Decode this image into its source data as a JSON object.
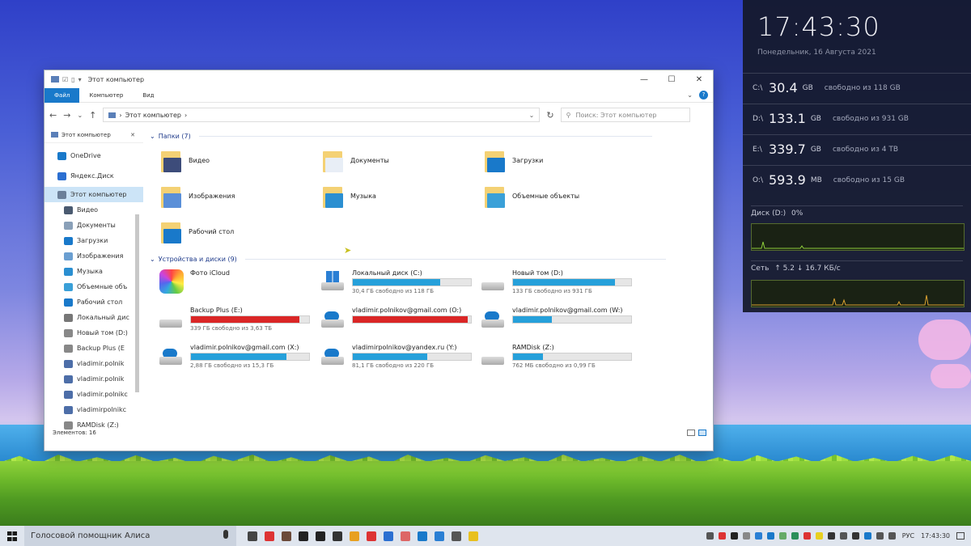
{
  "window": {
    "title": "Этот компьютер",
    "ribbon_tabs": [
      "Файл",
      "Компьютер",
      "Вид"
    ],
    "address_path": "Этот компьютер",
    "search_placeholder": "Поиск: Этот компьютер",
    "quick_access_label": "Этот компьютер",
    "status_text": "Элементов: 16"
  },
  "sidebar": {
    "items": [
      {
        "label": "OneDrive",
        "color": "#1979ca"
      },
      {
        "label": "Яндекс.Диск",
        "color": "#2b6fd1"
      },
      {
        "label": "Этот компьютер",
        "color": "#6b7f99"
      },
      {
        "label": "Видео",
        "color": "#4a5a70"
      },
      {
        "label": "Документы",
        "color": "#8aa0b8"
      },
      {
        "label": "Загрузки",
        "color": "#1979ca"
      },
      {
        "label": "Изображения",
        "color": "#6b9fd1"
      },
      {
        "label": "Музыка",
        "color": "#2b8fd1"
      },
      {
        "label": "Объемные объ",
        "color": "#3aa0d8"
      },
      {
        "label": "Рабочий стол",
        "color": "#1979ca"
      },
      {
        "label": "Локальный дис",
        "color": "#777"
      },
      {
        "label": "Новый том (D:)",
        "color": "#888"
      },
      {
        "label": "Backup Plus (E",
        "color": "#888"
      },
      {
        "label": "vladimir.polnik",
        "color": "#4d6ea8"
      },
      {
        "label": "vladimir.polnik",
        "color": "#4d6ea8"
      },
      {
        "label": "vladimir.polnikc",
        "color": "#4d6ea8"
      },
      {
        "label": "vladimirpolnikc",
        "color": "#4d6ea8"
      },
      {
        "label": "RAMDisk (Z:)",
        "color": "#888"
      }
    ]
  },
  "folders_group": "Папки (7)",
  "folders": [
    {
      "label": "Видео",
      "accent": "#3d4c7a"
    },
    {
      "label": "Документы",
      "accent": "#e8eef6"
    },
    {
      "label": "Загрузки",
      "accent": "#1979ca"
    },
    {
      "label": "Изображения",
      "accent": "#5a8fd8"
    },
    {
      "label": "Музыка",
      "accent": "#2b8fd1"
    },
    {
      "label": "Объемные объекты",
      "accent": "#3aa0d8"
    },
    {
      "label": "Рабочий стол",
      "accent": "#1979ca"
    }
  ],
  "devices_group": "Устройства и диски (9)",
  "drives": [
    {
      "label": "Фото iCloud",
      "kind": "icloud",
      "fill": null,
      "free": ""
    },
    {
      "label": "Локальный диск (C:)",
      "kind": "win",
      "fill": 0.74,
      "color": "#26a0da",
      "free": "30,4 ГБ свободно из 118 ГБ"
    },
    {
      "label": "Новый том (D:)",
      "kind": "hdd",
      "fill": 0.86,
      "color": "#26a0da",
      "free": "133 ГБ свободно из 931 ГБ"
    },
    {
      "label": "Backup Plus  (E:)",
      "kind": "hdd",
      "fill": 0.92,
      "color": "#da2626",
      "free": "339 ГБ свободно из 3,63 ТБ"
    },
    {
      "label": "vladimir.polnikov@gmail.com (O:)",
      "kind": "cloud",
      "fill": 0.97,
      "color": "#da2626",
      "free": ""
    },
    {
      "label": "vladimir.polnikov@gmail.com (W:)",
      "kind": "cloud",
      "fill": 0.33,
      "color": "#26a0da",
      "free": ""
    },
    {
      "label": "vladimir.polnikov@gmail.com (X:)",
      "kind": "cloud",
      "fill": 0.81,
      "color": "#26a0da",
      "free": "2,88 ГБ свободно из 15,3 ГБ"
    },
    {
      "label": "vladimirpolnikov@yandex.ru (Y:)",
      "kind": "cloud",
      "fill": 0.63,
      "color": "#26a0da",
      "free": "81,1 ГБ свободно из 220 ГБ"
    },
    {
      "label": "RAMDisk (Z:)",
      "kind": "hdd",
      "fill": 0.25,
      "color": "#26a0da",
      "free": "762 МБ свободно из 0,99 ГБ"
    }
  ],
  "widget": {
    "clock": "17:43:30",
    "date": "Понедельник, 16 Августа 2021",
    "disks": [
      {
        "letter": "C:\\",
        "value": "30.4",
        "unit": "GB",
        "free": "свободно из 118 GB"
      },
      {
        "letter": "D:\\",
        "value": "133.1",
        "unit": "GB",
        "free": "свободно из 931 GB"
      },
      {
        "letter": "E:\\",
        "value": "339.7",
        "unit": "GB",
        "free": "свободно из 4 TB"
      },
      {
        "letter": "O:\\",
        "value": "593.9",
        "unit": "MB",
        "free": "свободно из 15 GB"
      }
    ],
    "disk_activity_label": "Диск (D:)",
    "disk_activity_value": "0%",
    "net_label": "Сеть",
    "net_up": "5.2",
    "net_down": "16.7 КБ/с"
  },
  "taskbar": {
    "search_text": "Голосовой помощник Алиса",
    "lang": "РУС",
    "time": "17:43:30",
    "app_icon_colors": [
      "#444",
      "#d33",
      "#6b4a3a",
      "#222",
      "#222",
      "#333",
      "#e8a020",
      "#d33",
      "#2b6fd1",
      "#d66",
      "#1979ca",
      "#2a7fd4",
      "#555",
      "#e8c020"
    ],
    "tray_icon_colors": [
      "#555",
      "#d33",
      "#222",
      "#888",
      "#2a7fd4",
      "#1979ca",
      "#6a6",
      "#2b8f5a",
      "#d33",
      "#e8d020",
      "#333",
      "#555",
      "#333",
      "#1979ca",
      "#555",
      "#555"
    ]
  }
}
